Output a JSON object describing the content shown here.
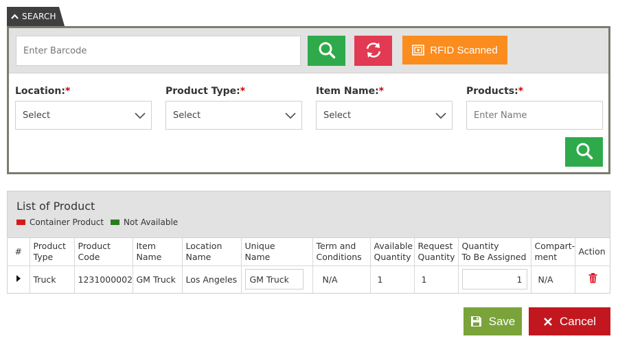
{
  "search": {
    "tab_label": "SEARCH",
    "barcode_placeholder": "Enter Barcode",
    "rfid_label": "RFID Scanned",
    "colors": {
      "green": "#2eaa4a",
      "red": "#e23a52",
      "orange": "#fb8c1e"
    }
  },
  "filters": {
    "location": {
      "label": "Location:",
      "required": "*",
      "value": "Select"
    },
    "product_type": {
      "label": "Product Type:",
      "required": "*",
      "value": "Select"
    },
    "item_name": {
      "label": "Item Name:",
      "required": "*",
      "value": "Select"
    },
    "products": {
      "label": "Products:",
      "required": "*",
      "placeholder": "Enter Name"
    }
  },
  "list": {
    "title": "List of Product",
    "legend": [
      {
        "label": "Container Product",
        "color": "#d21a1a"
      },
      {
        "label": "Not Available",
        "color": "#2a7d1e"
      }
    ],
    "columns": {
      "num": "#",
      "product_type": [
        "Product",
        "Type"
      ],
      "product_code": [
        "Product",
        "Code"
      ],
      "item_name": [
        "Item",
        "Name"
      ],
      "location_name": [
        "Location",
        "Name"
      ],
      "unique_name": [
        "Unique",
        "Name"
      ],
      "terms": [
        "Term and",
        "Conditions"
      ],
      "available_qty": [
        "Available",
        "Quantity"
      ],
      "request_qty": [
        "Request",
        "Quantity"
      ],
      "qty_assigned": [
        "Quantity",
        "To Be Assigned"
      ],
      "compartment": [
        "Compart-",
        "ment"
      ],
      "action": "Action"
    },
    "rows": [
      {
        "product_type": "Truck",
        "product_code": "1231000002",
        "item_name": "GM Truck",
        "location_name": "Los Angeles",
        "unique_name": "GM Truck",
        "terms": "N/A",
        "available_qty": "1",
        "request_qty": "1",
        "qty_assigned": "1",
        "compartment": "N/A"
      }
    ]
  },
  "footer": {
    "save_label": "Save",
    "cancel_label": "Cancel",
    "save_color": "#7aa33a",
    "cancel_color": "#c2171f"
  },
  "icons": {
    "search_tab": "chevron-up-icon",
    "search_button": "search-icon",
    "reset_button": "refresh-icon",
    "rfid_button": "rfid-icon",
    "select": "chevron-down-icon",
    "row_expand": "caret-right-icon",
    "row_delete": "trash-icon",
    "save": "save-icon",
    "cancel": "close-icon"
  }
}
